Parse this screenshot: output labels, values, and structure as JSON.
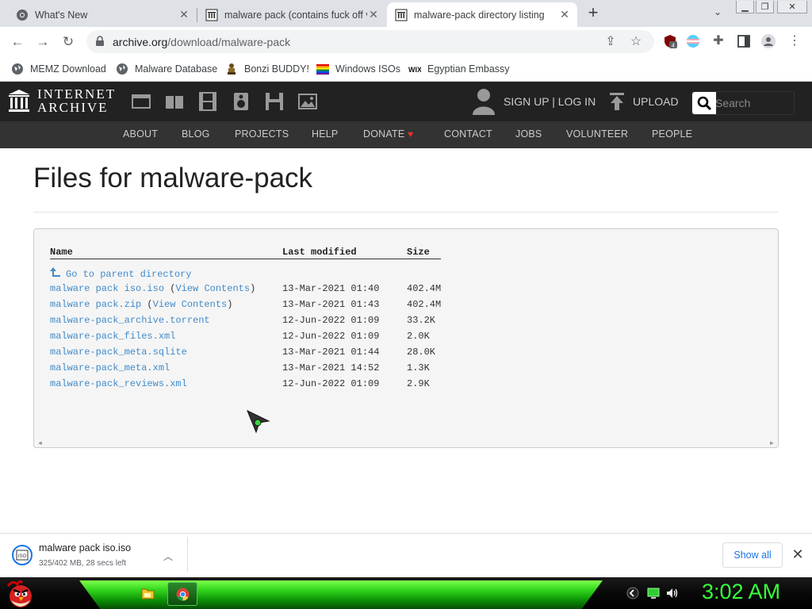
{
  "tabs": [
    {
      "title": "What's New",
      "active": false
    },
    {
      "title": "malware pack (contains fuck off v",
      "active": false
    },
    {
      "title": "malware-pack directory listing",
      "active": true
    }
  ],
  "toolbar": {
    "url_host": "archive.org",
    "url_path": "/download/malware-pack",
    "extension_badge": "4"
  },
  "bookmarks": [
    {
      "label": "MEMZ Download",
      "icon": "globe-icon"
    },
    {
      "label": "Malware Database",
      "icon": "globe-icon"
    },
    {
      "label": "Bonzi BUDDY!",
      "icon": "bonzi-icon"
    },
    {
      "label": "Windows ISOs",
      "icon": "windows-flag-icon"
    },
    {
      "label": "Egyptian Embassy",
      "icon": "wix-icon"
    }
  ],
  "ia": {
    "logo_line1": "INTERNET",
    "logo_line2": "ARCHIVE",
    "signup": "SIGN UP | LOG IN",
    "upload": "UPLOAD",
    "search_placeholder": "Search",
    "nav": [
      "ABOUT",
      "BLOG",
      "PROJECTS",
      "HELP",
      "DONATE",
      "CONTACT",
      "JOBS",
      "VOLUNTEER",
      "PEOPLE"
    ]
  },
  "page": {
    "title": "Files for malware-pack",
    "columns": {
      "name": "Name",
      "modified": "Last modified",
      "size": "Size"
    },
    "parent": "Go to parent directory",
    "view_contents": "View Contents",
    "files": [
      {
        "name": "malware pack iso.iso",
        "view": true,
        "modified": "13-Mar-2021 01:40",
        "size": "402.4M"
      },
      {
        "name": "malware pack.zip",
        "view": true,
        "modified": "13-Mar-2021 01:43",
        "size": "402.4M"
      },
      {
        "name": "malware-pack_archive.torrent",
        "view": false,
        "modified": "12-Jun-2022 01:09",
        "size": "33.2K"
      },
      {
        "name": "malware-pack_files.xml",
        "view": false,
        "modified": "12-Jun-2022 01:09",
        "size": "2.0K"
      },
      {
        "name": "malware-pack_meta.sqlite",
        "view": false,
        "modified": "13-Mar-2021 01:44",
        "size": "28.0K"
      },
      {
        "name": "malware-pack_meta.xml",
        "view": false,
        "modified": "13-Mar-2021 14:52",
        "size": "1.3K"
      },
      {
        "name": "malware-pack_reviews.xml",
        "view": false,
        "modified": "12-Jun-2022 01:09",
        "size": "2.9K"
      }
    ]
  },
  "download": {
    "file": "malware pack iso.iso",
    "status": "325/402 MB, 28 secs left",
    "show_all": "Show all",
    "icon_text": "ISO"
  },
  "taskbar": {
    "clock": "3:02 AM"
  },
  "colors": {
    "link": "#428bca",
    "ia_header": "#222222",
    "ia_nav": "#333333",
    "taskbar_green": "#2fd31c",
    "clock": "#3aff3a"
  }
}
